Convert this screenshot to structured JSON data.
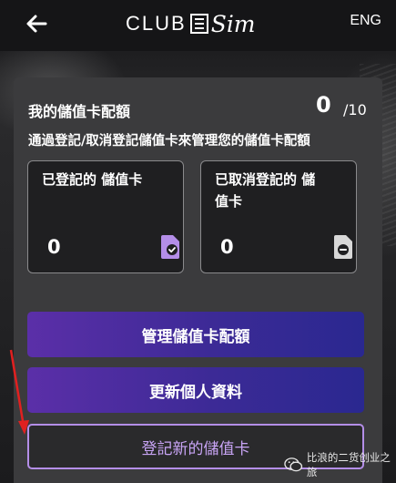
{
  "header": {
    "back_icon": "arrow-left-icon",
    "logo_club": "CLUB",
    "logo_sim": "Sim",
    "lang_label": "ENG"
  },
  "quota": {
    "title": "我的儲值卡配額",
    "count": "0",
    "total": "/10",
    "description": "通過登記/取消登記儲值卡來管理您的儲值卡配額"
  },
  "stats": {
    "registered": {
      "label": "已登記的 儲值卡",
      "value": "0",
      "icon": "sim-card-check-icon",
      "icon_color": "#b48ee8"
    },
    "unregistered": {
      "label": "已取消登記的 儲值卡",
      "value": "0",
      "icon": "sim-card-minus-icon",
      "icon_color": "#d8d8d8"
    }
  },
  "buttons": {
    "manage": "管理儲值卡配額",
    "update_profile": "更新個人資料",
    "register_new": "登記新的儲值卡"
  },
  "watermark": {
    "text": "比浪的二货创业之旅"
  },
  "colors": {
    "accent": "#b48ee8",
    "annotation_arrow": "#e02020",
    "button_gradient_start": "#5b2fa8",
    "button_gradient_end": "#2a2890"
  }
}
